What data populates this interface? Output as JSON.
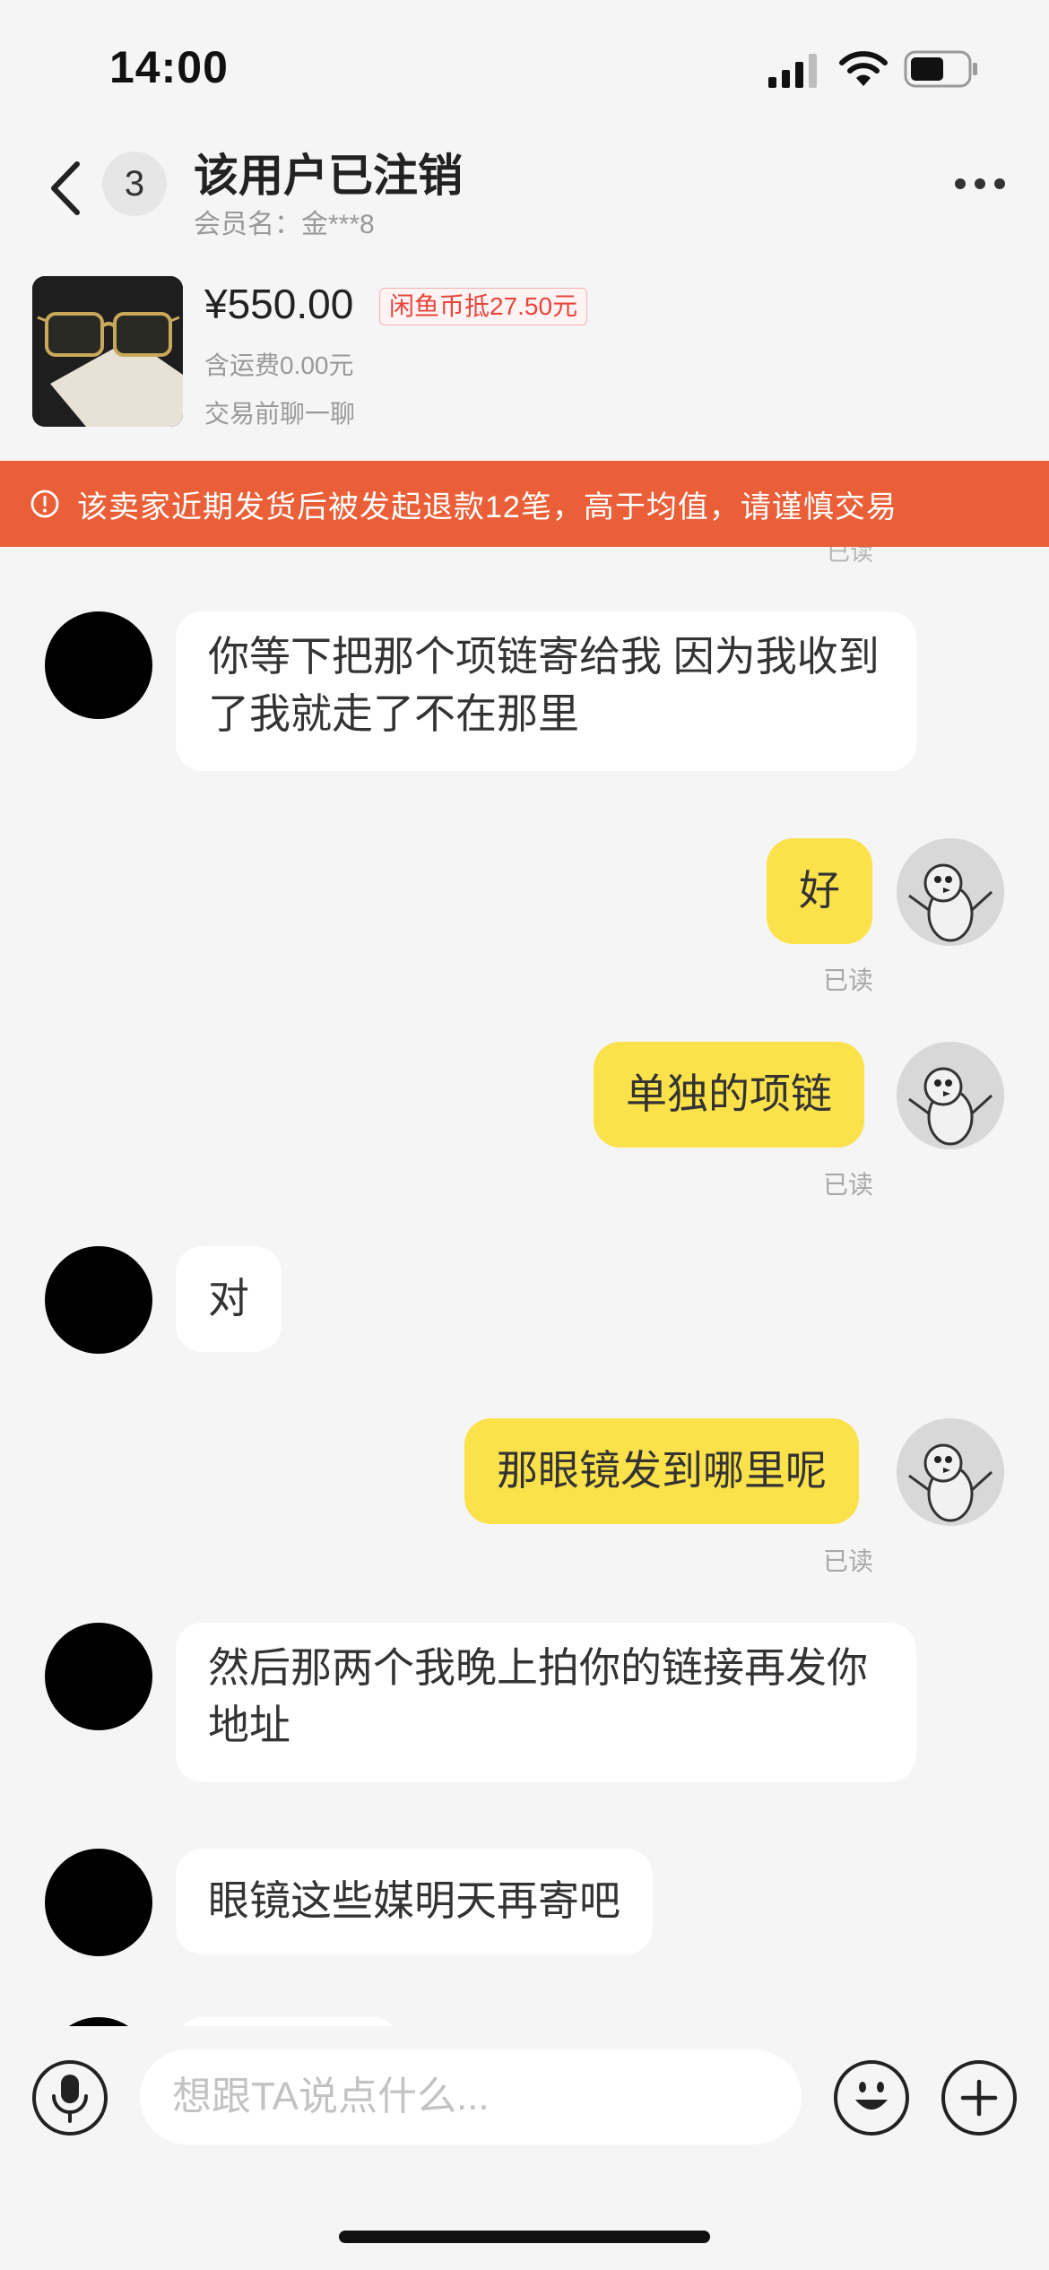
{
  "status_bar": {
    "time": "14:00"
  },
  "header": {
    "unread_count": "3",
    "title": "该用户已注销",
    "member_name": "会员名：金***8"
  },
  "product": {
    "price": "¥550.00",
    "coin_discount": "闲鱼币抵27.50元",
    "shipping": "含运费0.00元",
    "pre_trade_chat": "交易前聊一聊"
  },
  "warning": {
    "text": "该卖家近期发货后被发起退款12笔，高于均值，请谨慎交易"
  },
  "chat": {
    "peek_read": "已读",
    "messages": [
      {
        "side": "in",
        "text": "你等下把那个项链寄给我 因为我收到了我就走了不在那里"
      },
      {
        "side": "out",
        "text": "好",
        "status": "已读"
      },
      {
        "side": "out",
        "text": "单独的项链",
        "status": "已读"
      },
      {
        "side": "in",
        "text": "对"
      },
      {
        "side": "out",
        "text": "那眼镜发到哪里呢",
        "status": "已读"
      },
      {
        "side": "in",
        "text": "然后那两个我晚上拍你的链接再发你地址"
      },
      {
        "side": "in",
        "text": "眼镜这些媒明天再寄吧"
      }
    ]
  },
  "input": {
    "placeholder": "想跟TA说点什么..."
  },
  "colors": {
    "warning_bg": "#ea5f37",
    "my_bubble": "#fbe14a",
    "coin_tag_text": "#e8453c"
  },
  "icons": {
    "back": "chevron-left-icon",
    "more": "more-dots-icon",
    "warning": "exclamation-circle-icon",
    "mic": "microphone-icon",
    "emoji": "smiley-icon",
    "plus": "plus-icon"
  }
}
